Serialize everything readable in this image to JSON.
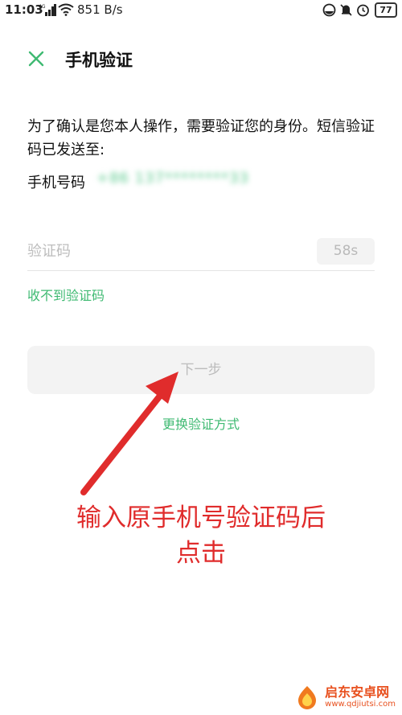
{
  "status_bar": {
    "time": "11:03",
    "network_label": "4G",
    "speed": "851 B/s",
    "battery": "77"
  },
  "header": {
    "title": "手机验证"
  },
  "intro": {
    "text": "为了确认是您本人操作，需要验证您的身份。短信验证码已发送至:"
  },
  "phone": {
    "label": "手机号码",
    "value": "+86 137********33"
  },
  "code_field": {
    "placeholder": "验证码",
    "countdown": "58s"
  },
  "links": {
    "no_code": "收不到验证码",
    "switch_method": "更换验证方式"
  },
  "buttons": {
    "next": "下一步"
  },
  "annotation": {
    "line1": "输入原手机号验证码后",
    "line2": "点击",
    "color": "#e02c2c"
  },
  "watermark": {
    "name": "启东安卓网",
    "url": "www.qdjiutsi.com"
  },
  "colors": {
    "accent_green": "#3fba72",
    "disabled_gray": "#f3f3f3"
  }
}
